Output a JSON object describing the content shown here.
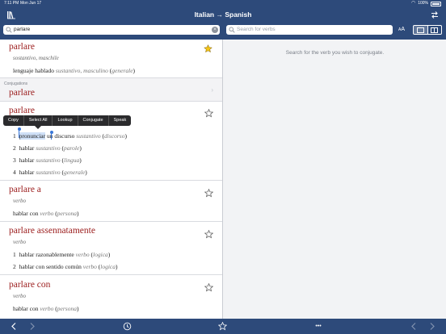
{
  "status": {
    "time": "7:11 PM",
    "date": "Mon Jun 17",
    "battery": "100%"
  },
  "nav": {
    "title": "Italian → Spanish"
  },
  "search": {
    "value": "parlare",
    "verbs_placeholder": "Search for verbs"
  },
  "font_size_label": {
    "small": "A",
    "large": "A"
  },
  "entries": [
    {
      "headword": "parlare",
      "pos": "sostantivo, maschile",
      "sense": {
        "main": "lenguaje hablado ",
        "tag": "sustantivo, masculino",
        "note": "generale"
      }
    },
    {
      "headword": "parlare",
      "senses": [
        {
          "num": "1",
          "main": "pronunciar",
          "rest": " un discurso ",
          "tag": "sustantivo",
          "note": "discorso"
        },
        {
          "num": "2",
          "main": "hablar ",
          "tag": "sustantivo",
          "note": "parole"
        },
        {
          "num": "3",
          "main": "hablar ",
          "tag": "sustantivo",
          "note": "lingua"
        },
        {
          "num": "4",
          "main": "hablar ",
          "tag": "sustantivo",
          "note": "generale"
        }
      ]
    },
    {
      "headword": "parlare a",
      "pos": "verbo",
      "sense": {
        "main": "hablar con ",
        "tag": "verbo",
        "note": "persona"
      }
    },
    {
      "headword": "parlare assennatamente",
      "pos": "verbo",
      "senses": [
        {
          "num": "1",
          "main": "hablar razonablemente ",
          "tag": "verbo",
          "note": "logica"
        },
        {
          "num": "2",
          "main": "hablar con sentido común ",
          "tag": "verbo",
          "note": "logica"
        }
      ]
    },
    {
      "headword": "parlare con",
      "pos": "verbo",
      "sense": {
        "main": "hablar con ",
        "tag": "verbo",
        "note": "persona"
      }
    }
  ],
  "conjugations": {
    "label": "Conjugations",
    "verb": "parlare"
  },
  "context_menu": [
    "Copy",
    "Select All",
    "Lookup",
    "Conjugate",
    "Speak"
  ],
  "right_pane": {
    "message": "Search for the verb you wish to conjugate."
  },
  "toolbar": {
    "more": "•••"
  },
  "colors": {
    "nav_bg": "#2d4a7a",
    "headword": "#9b1c1c",
    "star_favorite": "#f5c518",
    "ribbon": "#f5a623"
  }
}
